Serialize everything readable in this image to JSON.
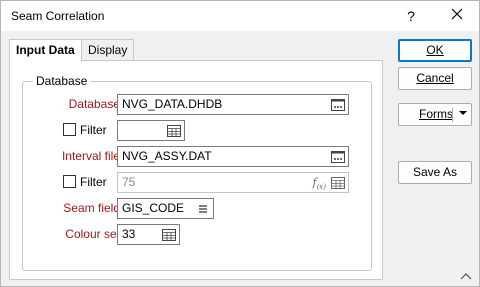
{
  "window": {
    "title": "Seam Correlation",
    "help_glyph": "?",
    "close_glyph": "✕"
  },
  "tabs": [
    {
      "label": "Input Data",
      "active": true
    },
    {
      "label": "Display",
      "active": false
    }
  ],
  "group": {
    "legend": "Database",
    "database": {
      "label": "Database",
      "value": "NVG_DATA.DHDB"
    },
    "filter1": {
      "label": "Filter",
      "value": "",
      "checked": false
    },
    "interval_file": {
      "label": "Interval file",
      "value": "NVG_ASSY.DAT"
    },
    "filter2": {
      "label": "Filter",
      "value": "75",
      "checked": false
    },
    "seam_field": {
      "label": "Seam field",
      "value": "GIS_CODE"
    },
    "colour_set": {
      "label": "Colour set",
      "value": "33"
    }
  },
  "buttons": {
    "ok": "OK",
    "cancel": "Cancel",
    "forms": "Forms",
    "save_as": "Save As"
  },
  "icons": {
    "browse": "ellipsis-browse-icon",
    "table": "table-icon",
    "fx": "fx-expression-icon",
    "list": "list-icon",
    "dropdown": "chevron-down-icon",
    "collapse": "chevron-up-icon"
  },
  "colors": {
    "required_label": "#a01818",
    "default_button_border": "#0078d4"
  }
}
